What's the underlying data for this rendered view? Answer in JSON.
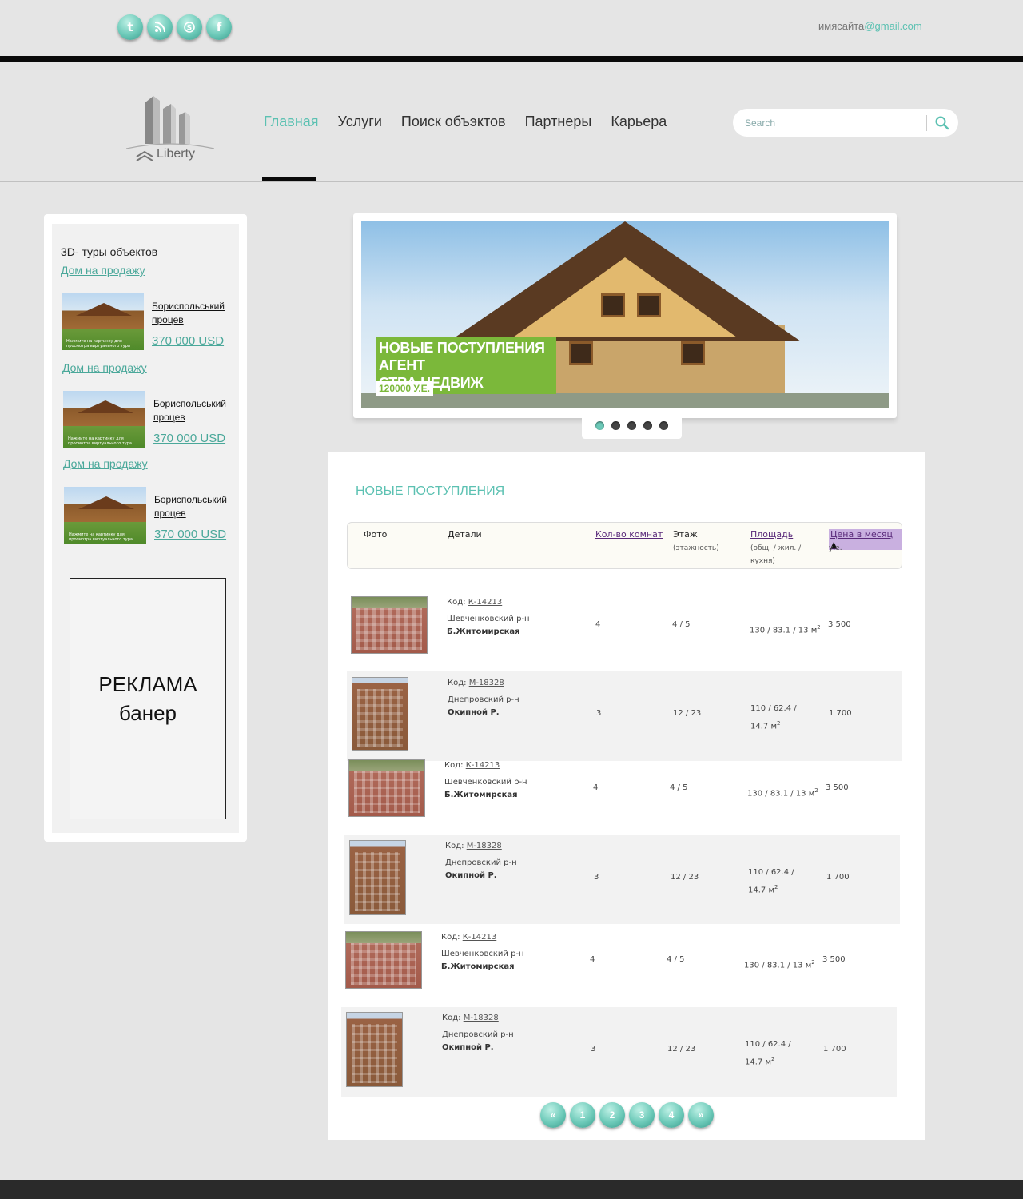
{
  "topbar": {
    "social": [
      {
        "icon": "twitter-icon",
        "glyph": "t"
      },
      {
        "icon": "rss-icon",
        "glyph": ")"
      },
      {
        "icon": "skype-icon",
        "glyph": "S"
      },
      {
        "icon": "facebook-icon",
        "glyph": "f"
      }
    ],
    "email_user": "имясайта",
    "email_domain": "@gmail.com"
  },
  "header": {
    "logo_text": "Liberty",
    "nav": [
      "Главная",
      "Услуги",
      "Поиск объэктов",
      "Партнеры",
      "Карьера"
    ],
    "active_nav": "Главная",
    "search_placeholder": "Search"
  },
  "sidebar": {
    "title": "3D- туры объектов",
    "items": [
      {
        "link": "Дом на продажу",
        "name_line1": "Бориспольський",
        "name_line2": "процев",
        "price": "370 000 USD",
        "caption": "Нажмите на картинку для просмотра виртуального тура"
      },
      {
        "link": "Дом на продажу",
        "name_line1": "Бориспольський",
        "name_line2": "процев",
        "price": "370 000 USD",
        "caption": "Нажмите на картинку для просмотра виртуального тура"
      },
      {
        "link": "Дом на продажу",
        "name_line1": "Бориспольський",
        "name_line2": "процев",
        "price": "370 000 USD",
        "caption": "Нажмите на картинку для просмотра виртуального тура"
      }
    ],
    "ad_line1": "РЕКЛАМА",
    "ad_line2": "банер"
  },
  "slider": {
    "caption_line1": "НОВЫЕ ПОСТУПЛЕНИЯ АГЕНТ",
    "caption_line2": "СТВА НЕДВИЖ",
    "price": "120000 У.Е.",
    "dot_count": 5,
    "active_dot": 0
  },
  "listing": {
    "title": "НОВЫЕ ПОСТУПЛЕНИЯ",
    "columns": {
      "photo": "Фото",
      "details": "Детали",
      "rooms": "Кол-во комнат",
      "floor": "Этаж",
      "floor_sub": "(этажность)",
      "area": "Площадь",
      "area_sub1": "(общ. / жил. /",
      "area_sub2": "кухня)",
      "price": "Цена в месяц",
      "price_sort": "▲",
      "price_sub": "у.е."
    },
    "code_label": "Код:",
    "rows": [
      {
        "code": "К-14213",
        "district": "Шевченковский р-н",
        "street": "Б.Житомирская",
        "rooms": "4",
        "floor": "4 / 5",
        "area": "130 / 83.1 / 13 м",
        "area2": "",
        "price": "3 500",
        "photo": "wide"
      },
      {
        "code": "М-18328",
        "district": "Днепровский р-н",
        "street": "Окипной Р.",
        "rooms": "3",
        "floor": "12 / 23",
        "area": "110 / 62.4 /",
        "area2": "14.7 м",
        "price": "1 700",
        "photo": "tall"
      },
      {
        "code": "К-14213",
        "district": "Шевченковский р-н",
        "street": "Б.Житомирская",
        "rooms": "4",
        "floor": "4 / 5",
        "area": "130 / 83.1 / 13 м",
        "area2": "",
        "price": "3 500",
        "photo": "wide"
      },
      {
        "code": "М-18328",
        "district": "Днепровский р-н",
        "street": "Окипной Р.",
        "rooms": "3",
        "floor": "12 / 23",
        "area": "110 / 62.4 /",
        "area2": "14.7 м",
        "price": "1 700",
        "photo": "tall"
      },
      {
        "code": "К-14213",
        "district": "Шевченковский р-н",
        "street": "Б.Житомирская",
        "rooms": "4",
        "floor": "4 / 5",
        "area": "130 / 83.1 / 13 м",
        "area2": "",
        "price": "3 500",
        "photo": "wide"
      },
      {
        "code": "М-18328",
        "district": "Днепровский р-н",
        "street": "Окипной Р.",
        "rooms": "3",
        "floor": "12 / 23",
        "area": "110 / 62.4 /",
        "area2": "14.7 м",
        "price": "1 700",
        "photo": "tall"
      }
    ],
    "sq_sup": "2"
  },
  "pagination": {
    "prev": "«",
    "pages": [
      "1",
      "2",
      "3",
      "4"
    ],
    "next": "»"
  },
  "colors": {
    "accent": "#5cc1b2",
    "link": "#4aa89a",
    "caption_green": "#7bb83a",
    "sort_highlight": "#c9b0e0"
  }
}
